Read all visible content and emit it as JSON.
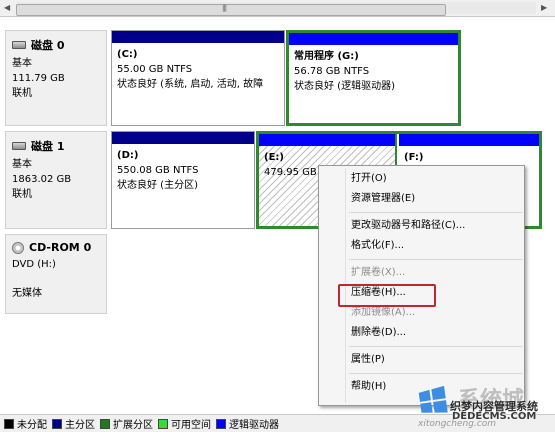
{
  "disks": [
    {
      "name": "磁盘 0",
      "type": "基本",
      "size": "111.79 GB",
      "status": "联机",
      "volumes": [
        {
          "label": "(C:)",
          "size": "55.00 GB NTFS",
          "status": "状态良好 (系统, 启动, 活动, 故障"
        },
        {
          "label": "常用程序  (G:)",
          "size": "56.78 GB NTFS",
          "status": "状态良好 (逻辑驱动器)"
        }
      ]
    },
    {
      "name": "磁盘 1",
      "type": "基本",
      "size": "1863.02 GB",
      "status": "联机",
      "volumes": [
        {
          "label": "(D:)",
          "size": "550.08 GB NTFS",
          "status": "状态良好 (主分区)"
        },
        {
          "label": "(E:)",
          "size": "479.95 GB"
        },
        {
          "label": "(F:)"
        }
      ]
    },
    {
      "name": "CD-ROM 0",
      "type": "DVD (H:)",
      "status": "无媒体"
    }
  ],
  "context_menu": {
    "items": [
      "打开(O)",
      "资源管理器(E)",
      "更改驱动器号和路径(C)...",
      "格式化(F)...",
      "扩展卷(X)...",
      "压缩卷(H)...",
      "添加镜像(A)...",
      "删除卷(D)...",
      "属性(P)",
      "帮助(H)"
    ]
  },
  "legend": [
    "未分配",
    "主分区",
    "扩展分区",
    "可用空间",
    "逻辑驱动器"
  ],
  "colors": {
    "unallocated": "#000000",
    "primary": "#00008b",
    "extended": "#1f7a1f",
    "free": "#33dd33",
    "logical": "#0000ff",
    "highlight": "#c1272d"
  },
  "watermark": {
    "brand": "系统城",
    "site_cn": "织梦内容管理系统",
    "site_url": "DEDECMS.COM",
    "site_url2": "xitongcheng.com"
  }
}
